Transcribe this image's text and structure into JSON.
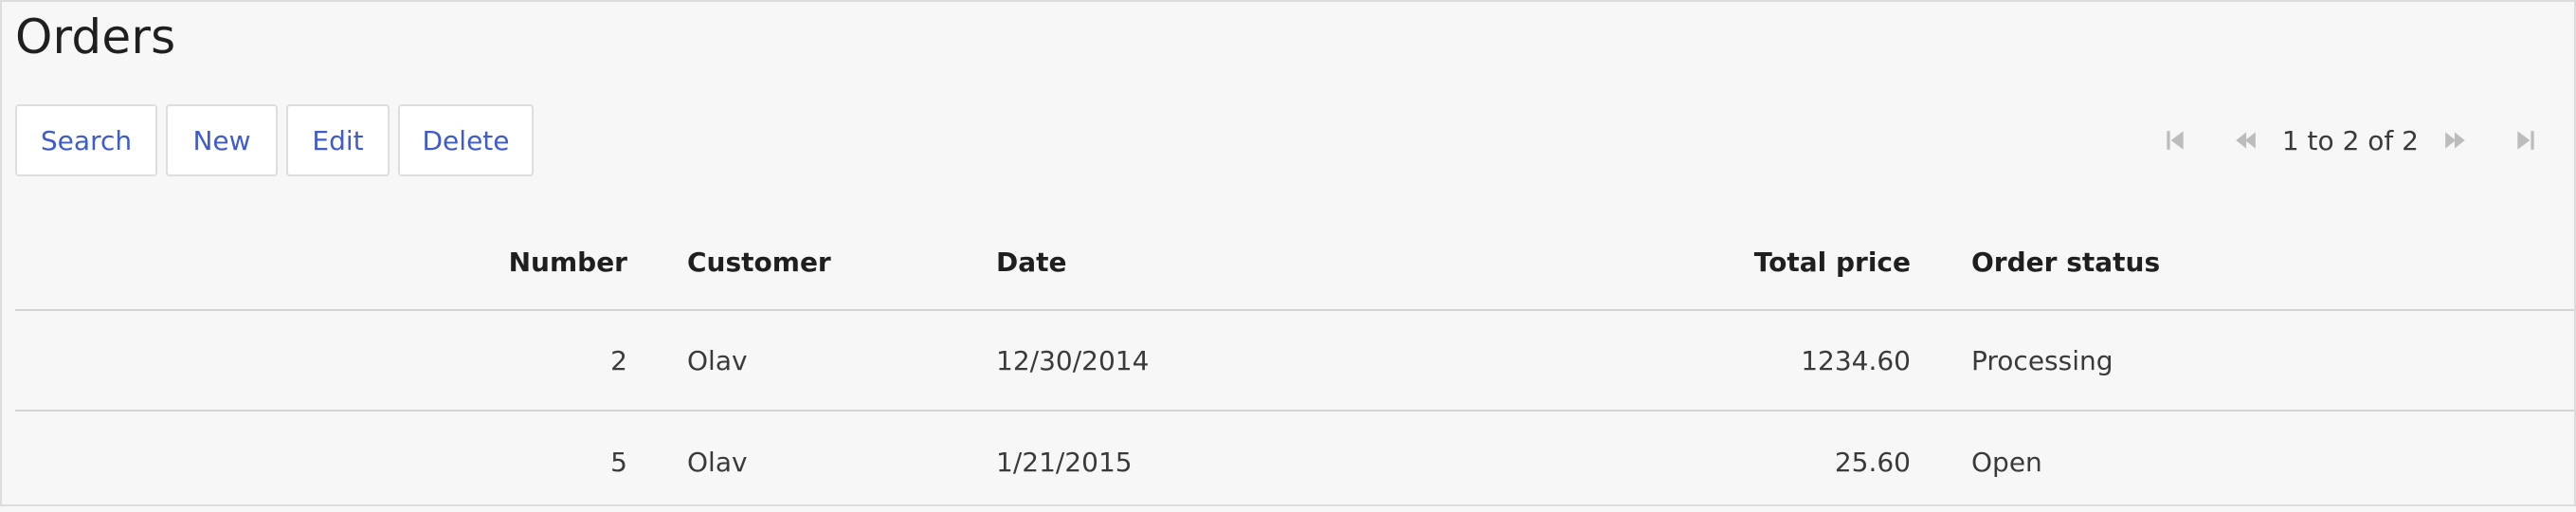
{
  "page": {
    "title": "Orders"
  },
  "toolbar": {
    "search_label": "Search",
    "new_label": "New",
    "edit_label": "Edit",
    "delete_label": "Delete"
  },
  "pager": {
    "status": "1 to 2 of 2",
    "first_icon": "first-page-icon",
    "prev_icon": "previous-page-icon",
    "next_icon": "next-page-icon",
    "last_icon": "last-page-icon"
  },
  "table": {
    "columns": [
      "Number",
      "Customer",
      "Date",
      "Total price",
      "Order status"
    ],
    "rows": [
      {
        "number": "2",
        "customer": "Olav",
        "date": "12/30/2014",
        "total": "1234.60",
        "status": "Processing"
      },
      {
        "number": "5",
        "customer": "Olav",
        "date": "1/21/2015",
        "total": "25.60",
        "status": "Open"
      }
    ]
  },
  "colors": {
    "background": "#f7f7f7",
    "button_text": "#3f5bcc",
    "border": "#dedede",
    "pager_icon_disabled": "#bcbcbc"
  }
}
